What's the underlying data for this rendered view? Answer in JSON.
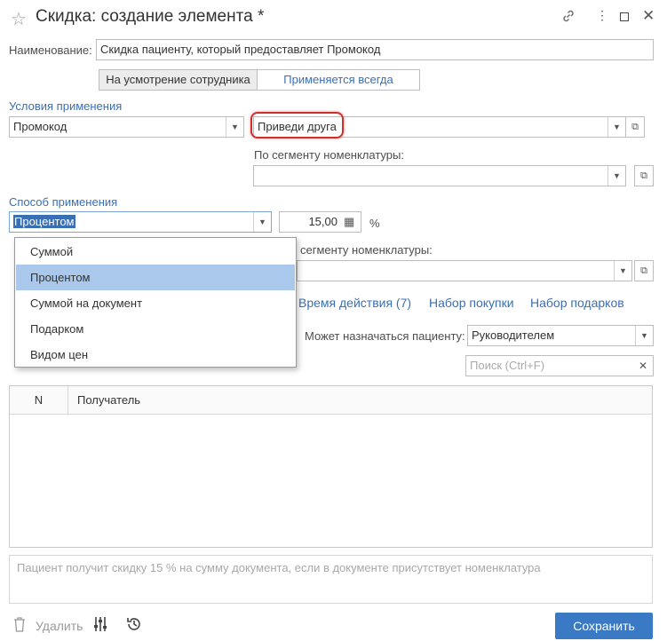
{
  "window": {
    "title": "Скидка: создание элемента *"
  },
  "form": {
    "name_label": "Наименование:",
    "name_value": "Скидка пациенту, который предоставляет Промокод",
    "mode_toggle": [
      "На усмотрение сотрудника",
      "Применяется всегда"
    ],
    "conditions_label": "Условия применения",
    "condition_value": "Промокод",
    "condition_param": "Приведи друга",
    "segment1_label": "По сегменту номенклатуры:",
    "method_label": "Способ применения",
    "method_value": "Процентом",
    "amount_value": "15,00",
    "percent_sign": "%",
    "segment2_label": "сегменту номенклатуры:",
    "assign_label": "Может назначаться пациенту:",
    "assign_value": "Руководителем",
    "search_placeholder": "Поиск (Ctrl+F)"
  },
  "dropdown": {
    "options": [
      "Суммой",
      "Процентом",
      "Суммой на документ",
      "Подарком",
      "Видом цен"
    ],
    "selected": "Процентом"
  },
  "tabs": [
    "Время действия (7)",
    "Набор покупки",
    "Набор подарков"
  ],
  "table": {
    "columns": [
      "N",
      "Получатель"
    ]
  },
  "note": "Пациент получит скидку 15 % на сумму документа, если в документе присутствует номенклатура",
  "footer": {
    "delete_label": "Удалить",
    "save_label": "Сохранить"
  },
  "icons": {
    "star": "star-icon",
    "link": "link-icon",
    "more": "more-icon",
    "maximize": "maximize-icon",
    "close": "close-icon",
    "trash": "trash-icon",
    "settings": "settings-icon",
    "history": "history-icon",
    "calculator": "calculator-icon",
    "open": "open-icon"
  },
  "colors": {
    "accent": "#3a6fb4",
    "save_button": "#3a79c4",
    "selected_item": "#a9c8ec",
    "highlight_ring": "#d0302c"
  }
}
